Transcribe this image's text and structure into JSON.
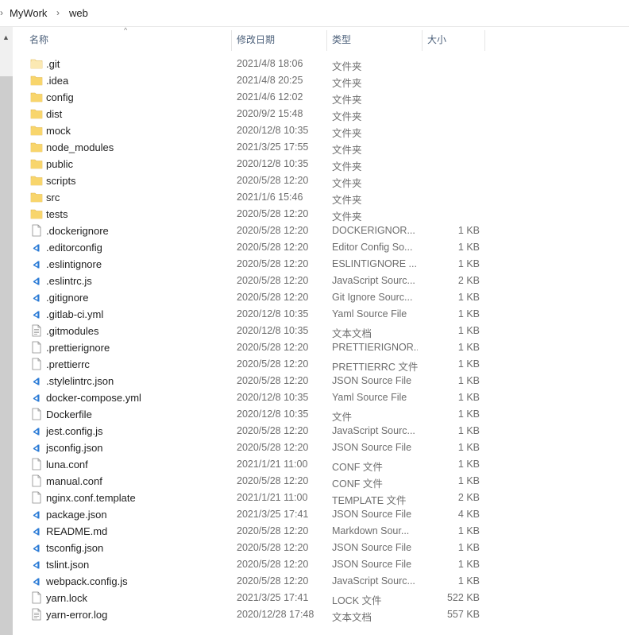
{
  "breadcrumb": [
    "MyWork",
    "web"
  ],
  "columns": {
    "name": "名称",
    "date": "修改日期",
    "type": "类型",
    "size": "大小"
  },
  "icon_colors": {
    "folder": "#f8d56c",
    "folder_faded": "#fbe9b3",
    "vscode": "#2b7bd6"
  },
  "files": [
    {
      "name": ".git",
      "date": "2021/4/8 18:06",
      "type": "文件夹",
      "size": "",
      "icon": "folder-icon-faded"
    },
    {
      "name": ".idea",
      "date": "2021/4/8 20:25",
      "type": "文件夹",
      "size": "",
      "icon": "folder-icon"
    },
    {
      "name": "config",
      "date": "2021/4/6 12:02",
      "type": "文件夹",
      "size": "",
      "icon": "folder-icon"
    },
    {
      "name": "dist",
      "date": "2020/9/2 15:48",
      "type": "文件夹",
      "size": "",
      "icon": "folder-icon"
    },
    {
      "name": "mock",
      "date": "2020/12/8 10:35",
      "type": "文件夹",
      "size": "",
      "icon": "folder-icon"
    },
    {
      "name": "node_modules",
      "date": "2021/3/25 17:55",
      "type": "文件夹",
      "size": "",
      "icon": "folder-icon"
    },
    {
      "name": "public",
      "date": "2020/12/8 10:35",
      "type": "文件夹",
      "size": "",
      "icon": "folder-icon"
    },
    {
      "name": "scripts",
      "date": "2020/5/28 12:20",
      "type": "文件夹",
      "size": "",
      "icon": "folder-icon"
    },
    {
      "name": "src",
      "date": "2021/1/6 15:46",
      "type": "文件夹",
      "size": "",
      "icon": "folder-icon"
    },
    {
      "name": "tests",
      "date": "2020/5/28 12:20",
      "type": "文件夹",
      "size": "",
      "icon": "folder-icon"
    },
    {
      "name": ".dockerignore",
      "date": "2020/5/28 12:20",
      "type": "DOCKERIGNOR...",
      "size": "1 KB",
      "icon": "file-icon"
    },
    {
      "name": ".editorconfig",
      "date": "2020/5/28 12:20",
      "type": "Editor Config So...",
      "size": "1 KB",
      "icon": "vscode-file-icon"
    },
    {
      "name": ".eslintignore",
      "date": "2020/5/28 12:20",
      "type": "ESLINTIGNORE ...",
      "size": "1 KB",
      "icon": "vscode-file-icon"
    },
    {
      "name": ".eslintrc.js",
      "date": "2020/5/28 12:20",
      "type": "JavaScript Sourc...",
      "size": "2 KB",
      "icon": "vscode-file-icon"
    },
    {
      "name": ".gitignore",
      "date": "2020/5/28 12:20",
      "type": "Git Ignore Sourc...",
      "size": "1 KB",
      "icon": "vscode-file-icon"
    },
    {
      "name": ".gitlab-ci.yml",
      "date": "2020/12/8 10:35",
      "type": "Yaml Source File",
      "size": "1 KB",
      "icon": "vscode-file-icon"
    },
    {
      "name": ".gitmodules",
      "date": "2020/12/8 10:35",
      "type": "文本文档",
      "size": "1 KB",
      "icon": "text-file-icon"
    },
    {
      "name": ".prettierignore",
      "date": "2020/5/28 12:20",
      "type": "PRETTIERIGNOR...",
      "size": "1 KB",
      "icon": "file-icon"
    },
    {
      "name": ".prettierrc",
      "date": "2020/5/28 12:20",
      "type": "PRETTIERRC 文件",
      "size": "1 KB",
      "icon": "file-icon"
    },
    {
      "name": ".stylelintrc.json",
      "date": "2020/5/28 12:20",
      "type": "JSON Source File",
      "size": "1 KB",
      "icon": "vscode-file-icon"
    },
    {
      "name": "docker-compose.yml",
      "date": "2020/12/8 10:35",
      "type": "Yaml Source File",
      "size": "1 KB",
      "icon": "vscode-file-icon"
    },
    {
      "name": "Dockerfile",
      "date": "2020/12/8 10:35",
      "type": "文件",
      "size": "1 KB",
      "icon": "file-icon"
    },
    {
      "name": "jest.config.js",
      "date": "2020/5/28 12:20",
      "type": "JavaScript Sourc...",
      "size": "1 KB",
      "icon": "vscode-file-icon"
    },
    {
      "name": "jsconfig.json",
      "date": "2020/5/28 12:20",
      "type": "JSON Source File",
      "size": "1 KB",
      "icon": "vscode-file-icon"
    },
    {
      "name": "luna.conf",
      "date": "2021/1/21 11:00",
      "type": "CONF 文件",
      "size": "1 KB",
      "icon": "file-icon"
    },
    {
      "name": "manual.conf",
      "date": "2020/5/28 12:20",
      "type": "CONF 文件",
      "size": "1 KB",
      "icon": "file-icon"
    },
    {
      "name": "nginx.conf.template",
      "date": "2021/1/21 11:00",
      "type": "TEMPLATE 文件",
      "size": "2 KB",
      "icon": "file-icon"
    },
    {
      "name": "package.json",
      "date": "2021/3/25 17:41",
      "type": "JSON Source File",
      "size": "4 KB",
      "icon": "vscode-file-icon"
    },
    {
      "name": "README.md",
      "date": "2020/5/28 12:20",
      "type": "Markdown Sour...",
      "size": "1 KB",
      "icon": "vscode-file-icon"
    },
    {
      "name": "tsconfig.json",
      "date": "2020/5/28 12:20",
      "type": "JSON Source File",
      "size": "1 KB",
      "icon": "vscode-file-icon"
    },
    {
      "name": "tslint.json",
      "date": "2020/5/28 12:20",
      "type": "JSON Source File",
      "size": "1 KB",
      "icon": "vscode-file-icon"
    },
    {
      "name": "webpack.config.js",
      "date": "2020/5/28 12:20",
      "type": "JavaScript Sourc...",
      "size": "1 KB",
      "icon": "vscode-file-icon"
    },
    {
      "name": "yarn.lock",
      "date": "2021/3/25 17:41",
      "type": "LOCK 文件",
      "size": "522 KB",
      "icon": "file-icon"
    },
    {
      "name": "yarn-error.log",
      "date": "2020/12/28 17:48",
      "type": "文本文档",
      "size": "557 KB",
      "icon": "text-file-icon"
    }
  ]
}
